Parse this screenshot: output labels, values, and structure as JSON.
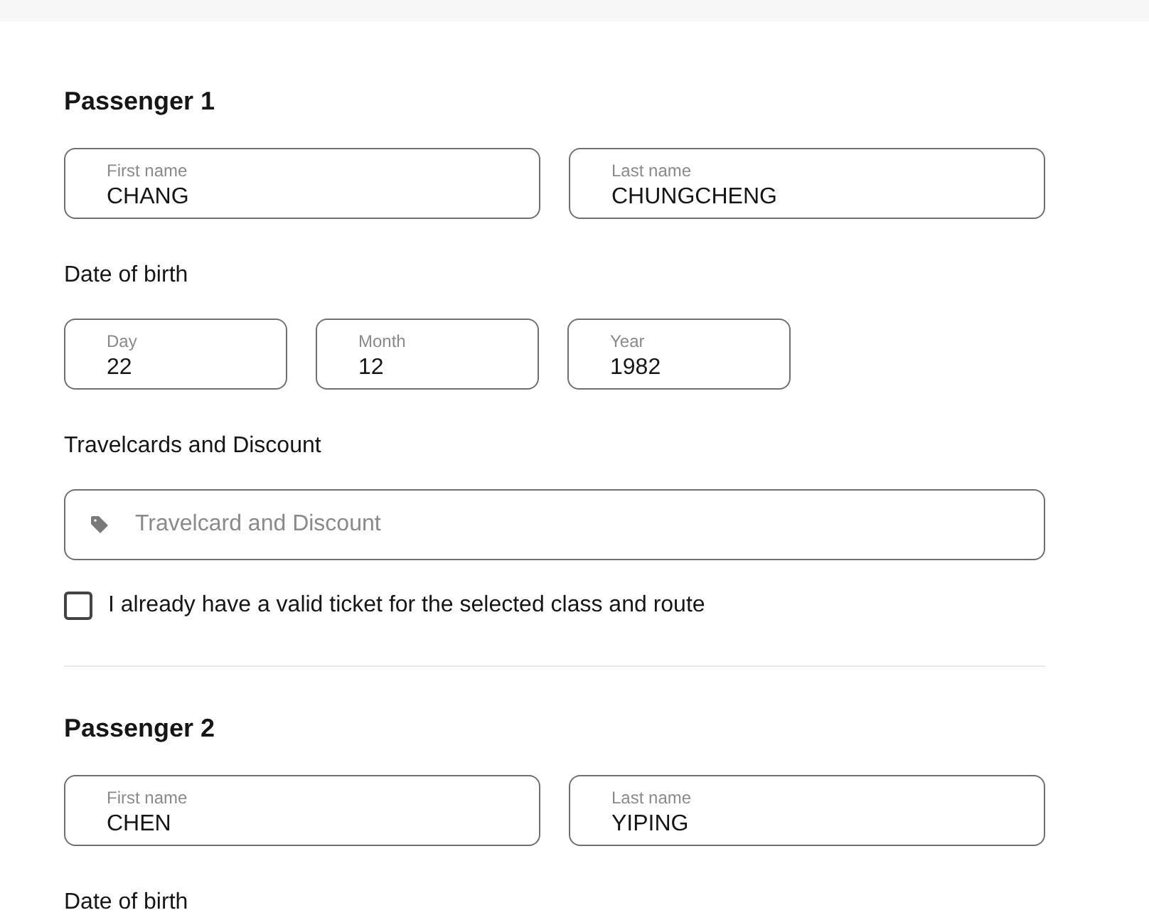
{
  "passengers": [
    {
      "heading": "Passenger 1",
      "name_fields": [
        {
          "label": "First name",
          "value": "CHANG"
        },
        {
          "label": "Last name",
          "value": "CHUNGCHENG"
        }
      ],
      "dob_label": "Date of birth",
      "dob_fields": [
        {
          "label": "Day",
          "value": "22"
        },
        {
          "label": "Month",
          "value": "12"
        },
        {
          "label": "Year",
          "value": "1982"
        }
      ],
      "travelcard": {
        "label": "Travelcards and Discount",
        "placeholder": "Travelcard and Discount"
      },
      "ticket_checkbox": {
        "label": "I already have a valid ticket for the selected class and route",
        "checked": false
      }
    },
    {
      "heading": "Passenger 2",
      "name_fields": [
        {
          "label": "First name",
          "value": "CHEN"
        },
        {
          "label": "Last name",
          "value": "YIPING"
        }
      ],
      "dob_label": "Date of birth"
    }
  ]
}
